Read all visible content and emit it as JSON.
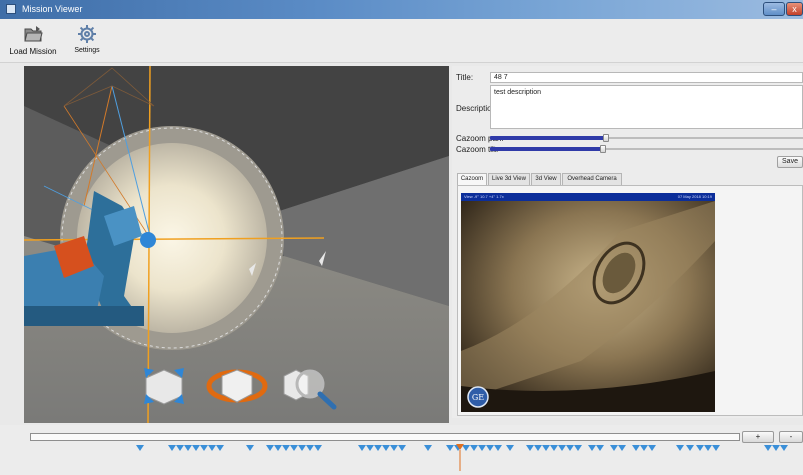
{
  "window": {
    "title": "Mission Viewer",
    "min_label": "–",
    "close_label": "x"
  },
  "toolbar": {
    "load_label": "Load Mission",
    "settings_label": "Settings"
  },
  "viewport": {
    "controls": [
      "zoom-extents-icon",
      "rotate-view-icon",
      "zoom-view-icon"
    ]
  },
  "form": {
    "title_label": "Title:",
    "title_value": "48 7",
    "description_label": "Description:",
    "description_value": "test description",
    "pan_label": "Cazoom pan:",
    "pan_value": 0.37,
    "tilt_label": "Cazoom tilt:",
    "tilt_value": 0.36,
    "save_label": "Save"
  },
  "tabs": [
    {
      "label": "Cazoom",
      "active": true
    },
    {
      "label": "Live 3d View",
      "active": false
    },
    {
      "label": "3d View",
      "active": false
    },
    {
      "label": "Overhead Camera",
      "active": false
    }
  ],
  "camera": {
    "overlay_left": "View  -9°  10.7  +4°  1.7x",
    "overlay_right": "07 May 2018 10:19",
    "logo": "GE"
  },
  "timeline": {
    "zoom_in_label": "+",
    "zoom_out_label": "-",
    "accent": "#3a8fd8",
    "cursor_color": "#e07020"
  }
}
